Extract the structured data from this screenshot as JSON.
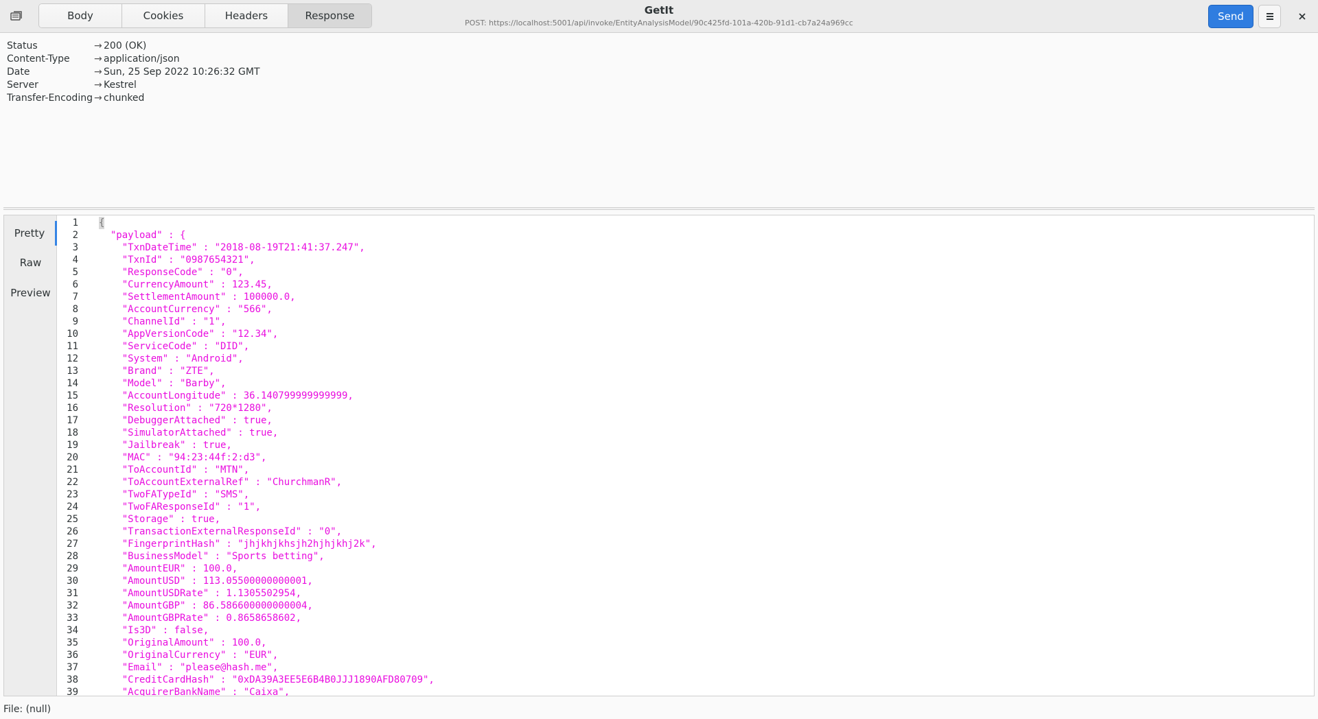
{
  "window": {
    "title": "GetIt",
    "subtitle": "POST: https://localhost:5001/api/invoke/EntityAnalysisModel/90c425fd-101a-420b-91d1-cb7a24a969cc"
  },
  "tabs": [
    {
      "label": "Body"
    },
    {
      "label": "Cookies"
    },
    {
      "label": "Headers"
    },
    {
      "label": "Response"
    }
  ],
  "active_tab": "Response",
  "send_label": "Send",
  "response_headers": [
    {
      "name": "Status",
      "value": "200 (OK)"
    },
    {
      "name": "Content-Type",
      "value": "application/json"
    },
    {
      "name": "Date",
      "value": "Sun, 25 Sep 2022 10:26:32 GMT"
    },
    {
      "name": "Server",
      "value": "Kestrel"
    },
    {
      "name": "Transfer-Encoding",
      "value": "chunked"
    }
  ],
  "header_arrow": "→",
  "view_tabs": [
    {
      "label": "Pretty"
    },
    {
      "label": "Raw"
    },
    {
      "label": "Preview"
    }
  ],
  "code_lines": [
    "{",
    "  \"payload\" : {",
    "    \"TxnDateTime\" : \"2018-08-19T21:41:37.247\",",
    "    \"TxnId\" : \"0987654321\",",
    "    \"ResponseCode\" : \"0\",",
    "    \"CurrencyAmount\" : 123.45,",
    "    \"SettlementAmount\" : 100000.0,",
    "    \"AccountCurrency\" : \"566\",",
    "    \"ChannelId\" : \"1\",",
    "    \"AppVersionCode\" : \"12.34\",",
    "    \"ServiceCode\" : \"DID\",",
    "    \"System\" : \"Android\",",
    "    \"Brand\" : \"ZTE\",",
    "    \"Model\" : \"Barby\",",
    "    \"AccountLongitude\" : 36.140799999999999,",
    "    \"Resolution\" : \"720*1280\",",
    "    \"DebuggerAttached\" : true,",
    "    \"SimulatorAttached\" : true,",
    "    \"Jailbreak\" : true,",
    "    \"MAC\" : \"94:23:44f:2:d3\",",
    "    \"ToAccountId\" : \"MTN\",",
    "    \"ToAccountExternalRef\" : \"ChurchmanR\",",
    "    \"TwoFATypeId\" : \"SMS\",",
    "    \"TwoFAResponseId\" : \"1\",",
    "    \"Storage\" : true,",
    "    \"TransactionExternalResponseId\" : \"0\",",
    "    \"FingerprintHash\" : \"jhjkhjkhsjh2hjhjkhj2k\",",
    "    \"BusinessModel\" : \"Sports betting\",",
    "    \"AmountEUR\" : 100.0,",
    "    \"AmountUSD\" : 113.05500000000001,",
    "    \"AmountUSDRate\" : 1.1305502954,",
    "    \"AmountGBP\" : 86.586600000000004,",
    "    \"AmountGBPRate\" : 0.8658658602,",
    "    \"Is3D\" : false,",
    "    \"OriginalAmount\" : 100.0,",
    "    \"OriginalCurrency\" : \"EUR\",",
    "    \"Email\" : \"please@hash.me\",",
    "    \"CreditCardHash\" : \"0xDA39A3EE5E6B4B0JJJ1890AFD80709\",",
    "    \"AcquirerBankName\" : \"Caixa\","
  ],
  "status_bar": "File: (null)",
  "colors": {
    "json_text": "#e90ddf",
    "accent": "#3584e4",
    "send_button": "#2f7de0"
  }
}
